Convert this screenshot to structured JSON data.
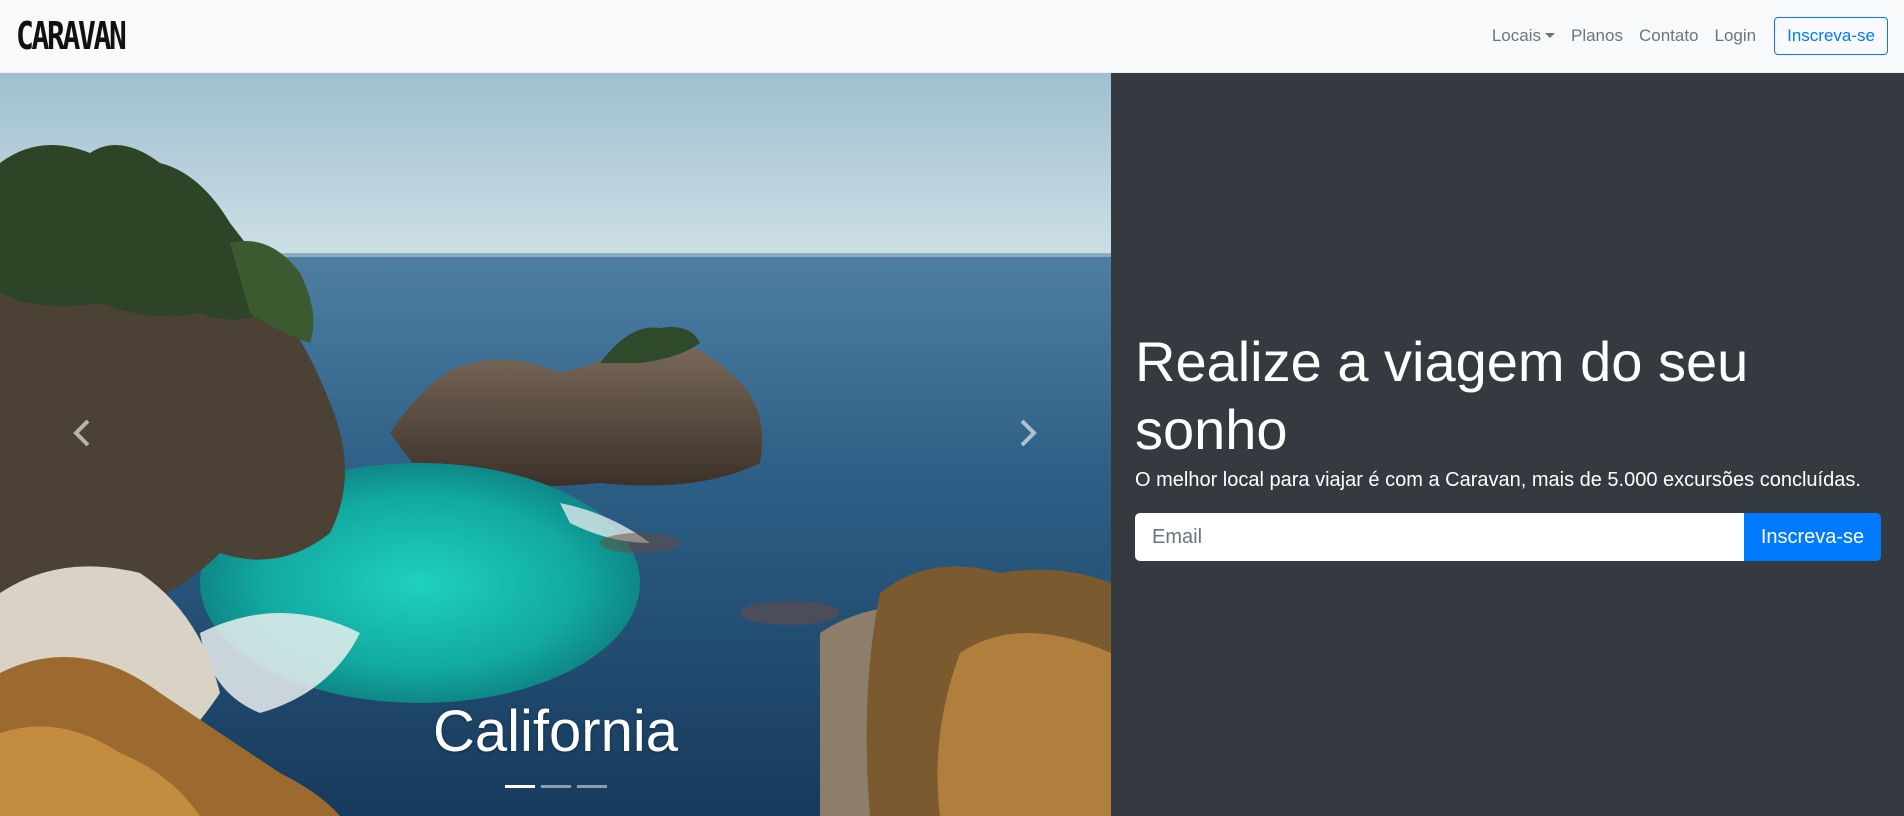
{
  "navbar": {
    "brand": "CARAVAN",
    "links": [
      {
        "label": "Locais",
        "dropdown": true
      },
      {
        "label": "Planos"
      },
      {
        "label": "Contato"
      },
      {
        "label": "Login"
      }
    ],
    "signup_label": "Inscreva-se"
  },
  "carousel": {
    "caption": "California",
    "slides_count": 3,
    "active_index": 0,
    "prev_icon": "chevron-left-icon",
    "next_icon": "chevron-right-icon"
  },
  "hero": {
    "headline": "Realize a viagem do seu sonho",
    "subtitle": "O melhor local para viajar é com a Caravan, mais de 5.000 excursões concluídas.",
    "email_placeholder": "Email",
    "submit_label": "Inscreva-se"
  },
  "colors": {
    "primary": "#007bff",
    "panel_bg": "#343a40",
    "navbar_bg": "#f8f9fa"
  }
}
